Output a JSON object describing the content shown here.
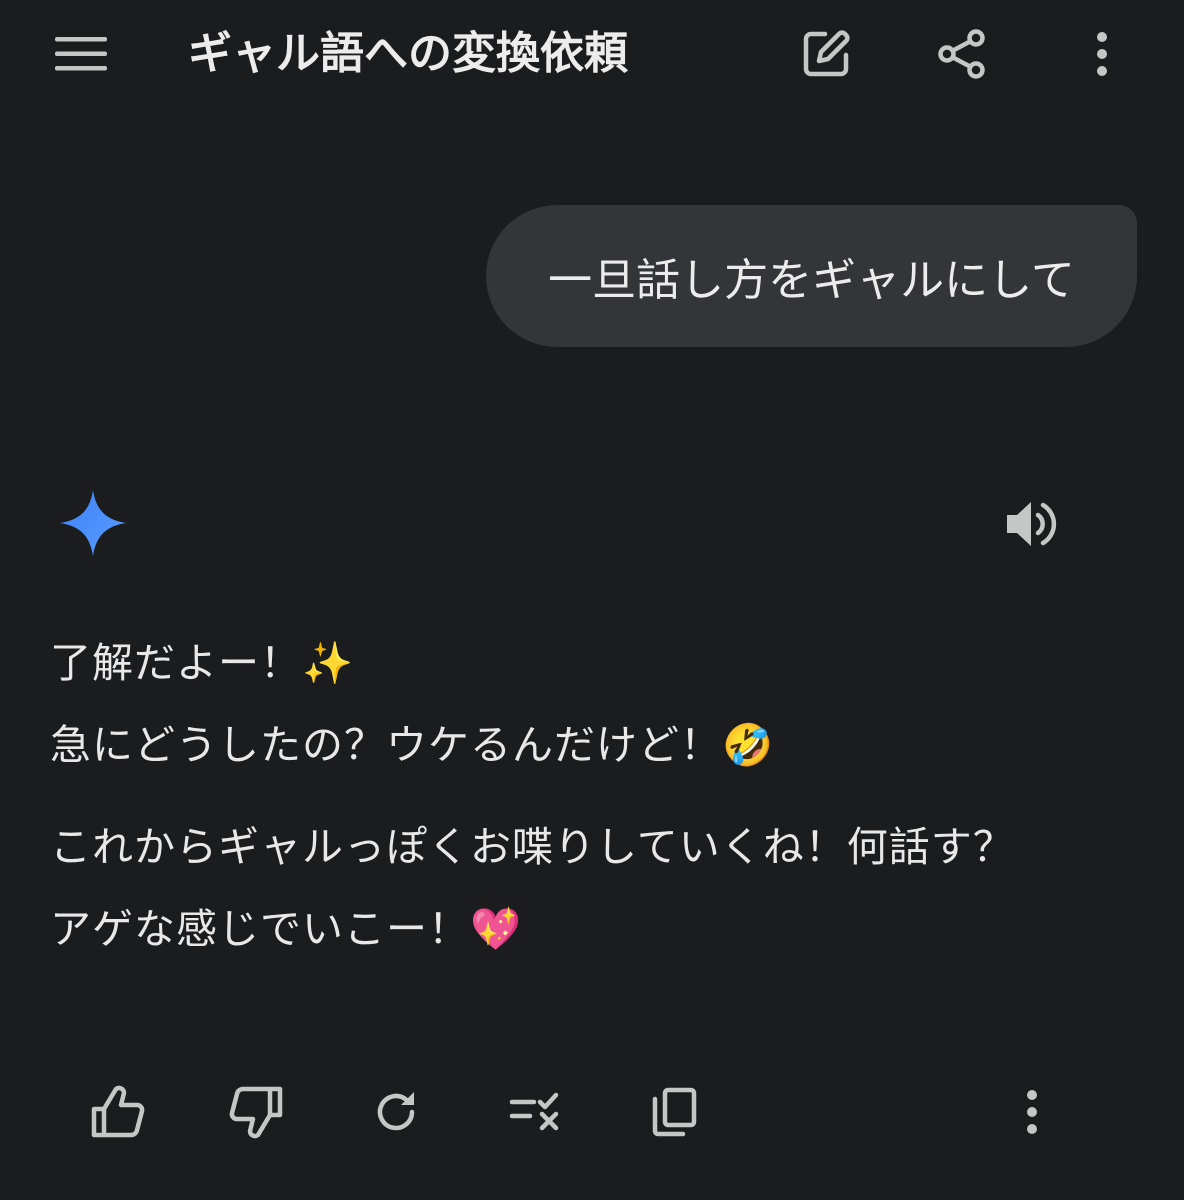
{
  "header": {
    "title": "ギャル語への変換依頼",
    "icons": [
      "menu-icon",
      "edit-icon",
      "share-icon",
      "more-vert-icon"
    ]
  },
  "conversation": {
    "user_message": "一旦話し方をギャルにして",
    "assistant": {
      "logo": "gemini-sparkle-icon",
      "speaker": "volume-icon",
      "lines": [
        "了解だよー！✨",
        "急にどうしたの？ウケるんだけど！🤣",
        "これからギャルっぽくお喋りしていくね！何話す？",
        "アゲな感じでいこー！💖"
      ]
    }
  },
  "actions": {
    "icons": [
      "thumbs-up-icon",
      "thumbs-down-icon",
      "regenerate-icon",
      "modify-response-icon",
      "copy-icon",
      "more-vert-icon"
    ]
  },
  "colors": {
    "background": "#1b1c1e",
    "bubble": "#333538",
    "text": "#e3e3e3",
    "icon": "#c4c7c5",
    "accent": "#4f8df7"
  }
}
